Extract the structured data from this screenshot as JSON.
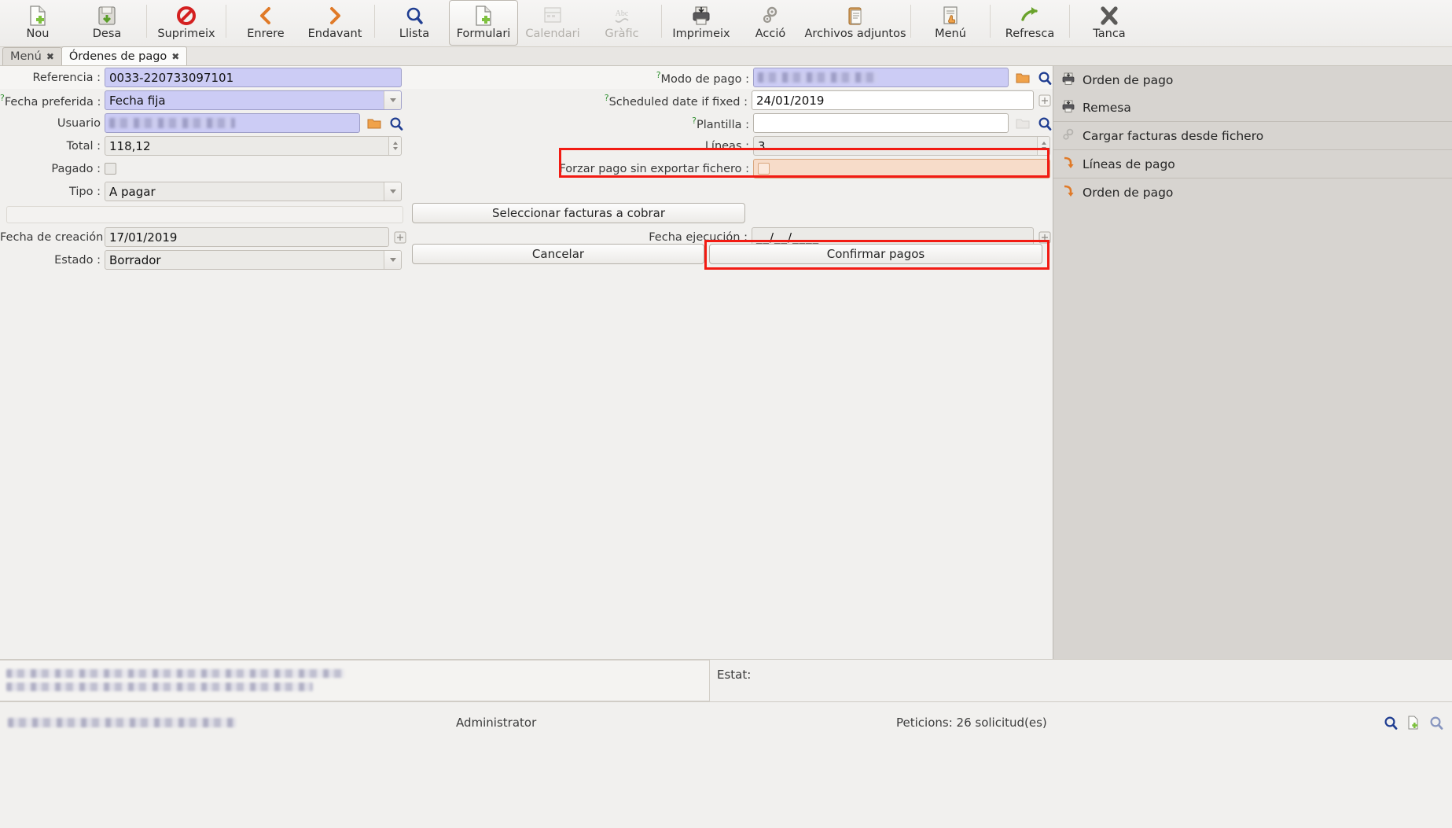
{
  "toolbar": {
    "buttons": [
      {
        "label": "Nou",
        "icon": "new-document-icon",
        "state": "enabled"
      },
      {
        "label": "Desa",
        "icon": "save-disk-icon",
        "state": "enabled"
      },
      {
        "label": "Suprimeix",
        "icon": "delete-forbidden-icon",
        "state": "enabled"
      },
      {
        "label": "Enrere",
        "icon": "back-chevron-icon",
        "state": "enabled"
      },
      {
        "label": "Endavant",
        "icon": "forward-chevron-icon",
        "state": "enabled"
      },
      {
        "label": "Llista",
        "icon": "list-search-icon",
        "state": "enabled"
      },
      {
        "label": "Formulari",
        "icon": "form-document-icon",
        "state": "active"
      },
      {
        "label": "Calendari",
        "icon": "calendar-icon",
        "state": "disabled"
      },
      {
        "label": "Gràfic",
        "icon": "chart-abc-icon",
        "state": "disabled"
      },
      {
        "label": "Imprimeix",
        "icon": "printer-icon",
        "state": "enabled"
      },
      {
        "label": "Acció",
        "icon": "gears-icon",
        "state": "enabled"
      },
      {
        "label": "Archivos adjuntos",
        "icon": "clipboard-attachment-icon",
        "state": "enabled"
      },
      {
        "label": "Menú",
        "icon": "menu-hand-icon",
        "state": "enabled"
      },
      {
        "label": "Refresca",
        "icon": "refresh-arrow-icon",
        "state": "enabled"
      },
      {
        "label": "Tanca",
        "icon": "close-x-icon",
        "state": "enabled"
      }
    ]
  },
  "tabs": [
    {
      "label": "Menú",
      "selected": false,
      "close": "✖"
    },
    {
      "label": "Órdenes de pago",
      "selected": true,
      "close": "✖"
    }
  ],
  "form": {
    "left": [
      {
        "label": "Referencia :",
        "value": "0033-220733097101",
        "type": "text",
        "style": "required"
      },
      {
        "label": "Fecha preferida :",
        "value": "Fecha fija",
        "type": "combo",
        "style": "required",
        "help": "?"
      },
      {
        "label": "Usuario",
        "value": "",
        "type": "lookup",
        "style": "required",
        "masked": true
      },
      {
        "label": "Total :",
        "value": "118,12",
        "type": "spinner",
        "style": "readonly"
      },
      {
        "label": "Pagado :",
        "value": "",
        "type": "checkbox",
        "style": "readonly"
      },
      {
        "label": "Tipo :",
        "value": "A pagar",
        "type": "combo",
        "style": "readonly"
      },
      {
        "label": "Fecha de creación :",
        "value": "17/01/2019",
        "type": "date",
        "style": "readonly"
      },
      {
        "label": "Estado :",
        "value": "Borrador",
        "type": "combo",
        "style": "readonly"
      }
    ],
    "right": [
      {
        "label": "Modo de pago :",
        "value": "",
        "type": "lookup",
        "style": "required",
        "masked": true,
        "help": "?"
      },
      {
        "label": "Scheduled date if fixed :",
        "value": "24/01/2019",
        "type": "date",
        "style": "normal",
        "help": "?"
      },
      {
        "label": "Plantilla :",
        "value": "",
        "type": "lookup",
        "style": "normal",
        "help": "?"
      },
      {
        "label": "Líneas :",
        "value": "3",
        "type": "spinner",
        "style": "readonly"
      },
      {
        "label": "Forzar pago sin exportar fichero :",
        "value": "",
        "type": "checkbox",
        "style": "highlight"
      },
      {
        "label": "Fecha ejecución :",
        "value": "__/__/____",
        "type": "date",
        "style": "readonly"
      }
    ],
    "buttons": {
      "select_invoices": "Seleccionar facturas a cobrar",
      "cancel": "Cancelar",
      "confirm": "Confirmar pagos"
    }
  },
  "sidebar": {
    "items": [
      {
        "label": "Orden de pago",
        "icon": "printer-icon"
      },
      {
        "label": "Remesa",
        "icon": "printer-icon"
      },
      {
        "label": "Cargar facturas desde fichero",
        "icon": "import-gear-icon"
      },
      {
        "label": "Líneas de pago",
        "icon": "orange-arrow-icon"
      },
      {
        "label": "Orden de pago",
        "icon": "orange-arrow-icon"
      }
    ]
  },
  "statusbar": {
    "estat_label": "Estat:",
    "estat_value": "",
    "user": "Administrator",
    "requests": "Peticions:  26 solicitud(es)",
    "icons": [
      "search-icon",
      "new-search-icon",
      "advanced-search-icon"
    ]
  },
  "colors": {
    "annotation": "#f21b13",
    "required_field": "#ccccf5",
    "highlight_field": "#f7dcc9",
    "accent_orange": "#e07a28"
  }
}
